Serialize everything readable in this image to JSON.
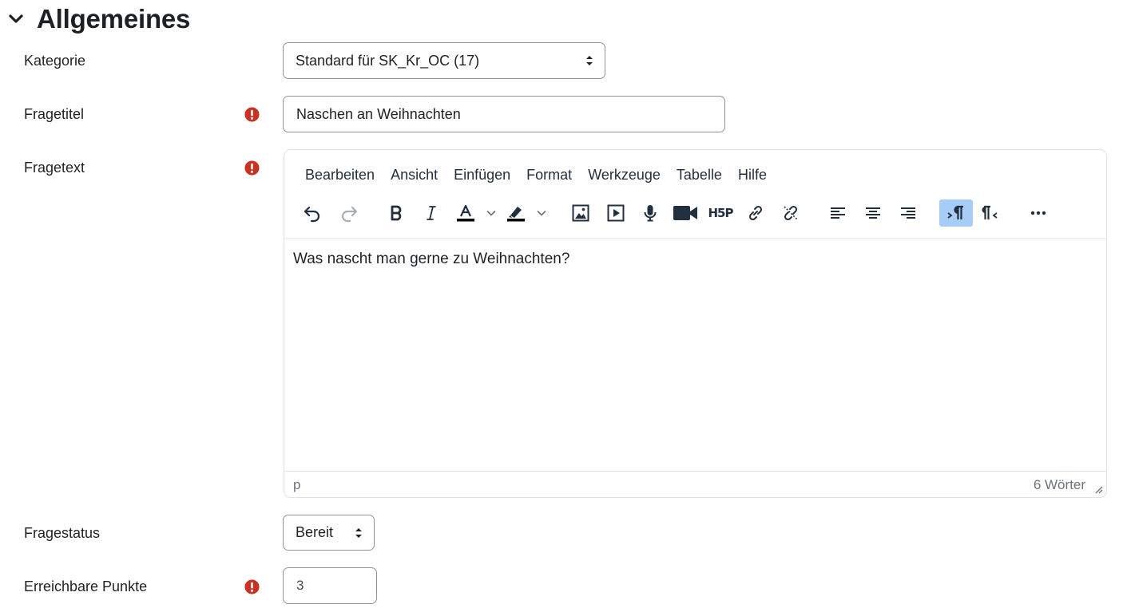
{
  "section": {
    "title": "Allgemeines"
  },
  "fields": {
    "category": {
      "label": "Kategorie",
      "value": "Standard für SK_Kr_OC (17)"
    },
    "title": {
      "label": "Fragetitel",
      "value": "Naschen an Weihnachten"
    },
    "text": {
      "label": "Fragetext"
    },
    "status": {
      "label": "Fragestatus",
      "value": "Bereit"
    },
    "points": {
      "label": "Erreichbare Punkte",
      "value": "3"
    }
  },
  "editor": {
    "menu": [
      "Bearbeiten",
      "Ansicht",
      "Einfügen",
      "Format",
      "Werkzeuge",
      "Tabelle",
      "Hilfe"
    ],
    "h5p_label": "H5P",
    "content": "Was nascht man gerne zu Weihnachten?",
    "status_path": "p",
    "word_count": "6 Wörter"
  },
  "colors": {
    "required": "#ca3120",
    "active_button": "#a6ccf7",
    "border": "#8f959e"
  }
}
